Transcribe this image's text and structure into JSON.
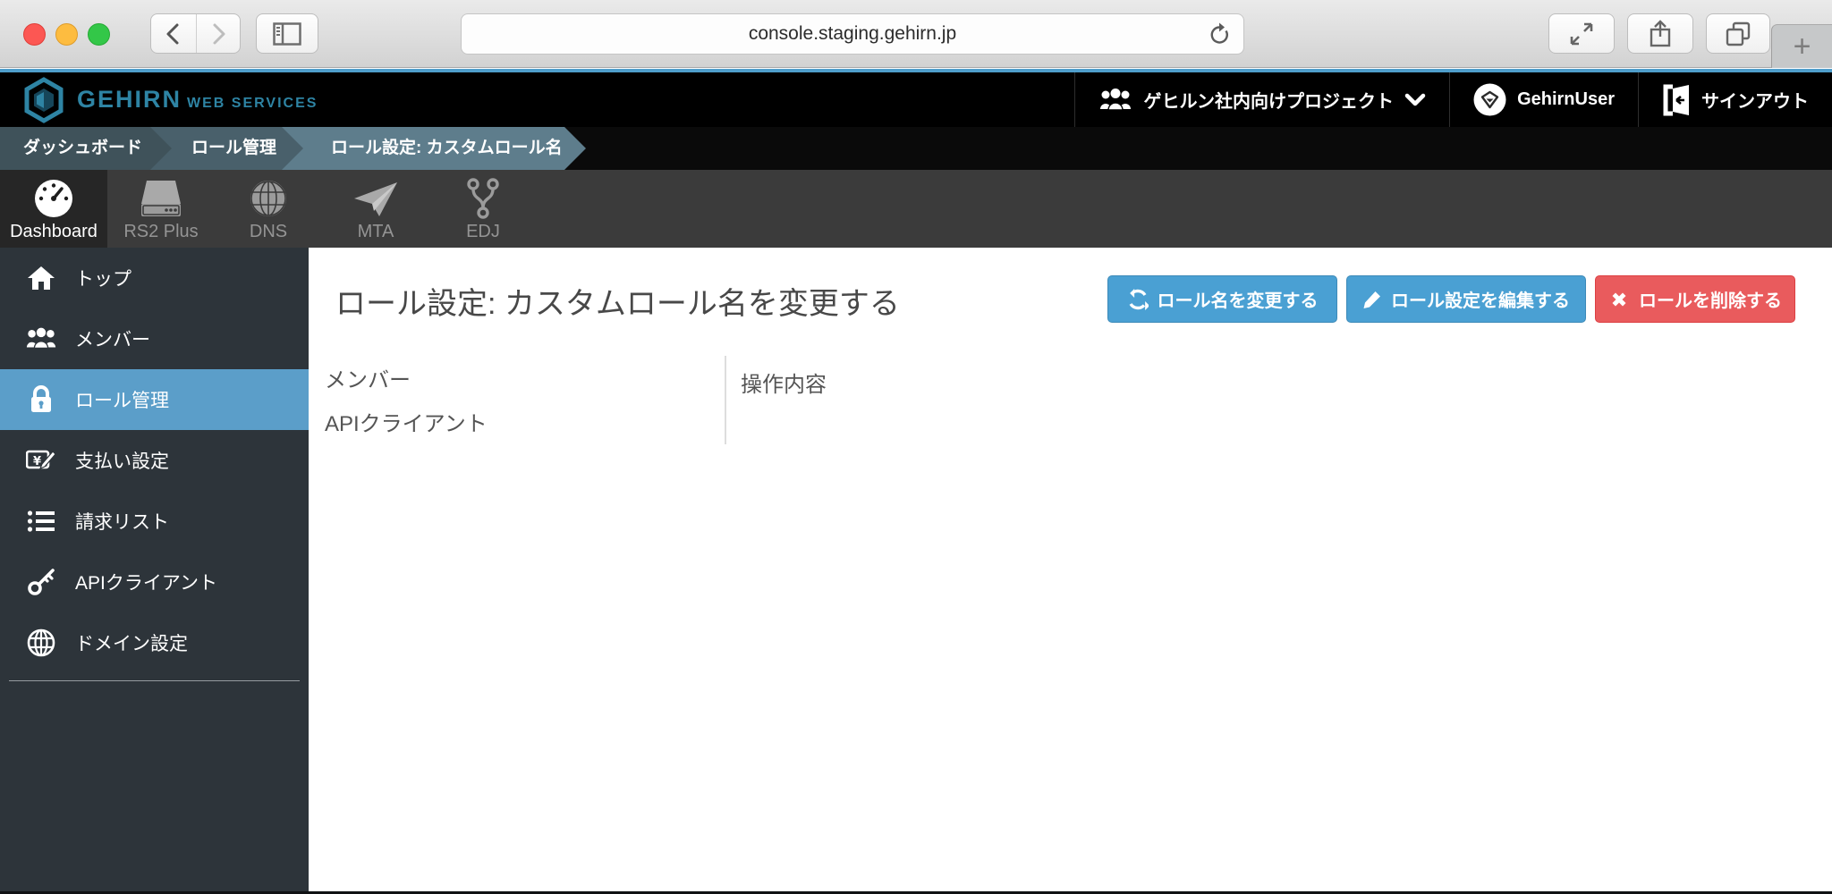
{
  "browser": {
    "url": "console.staging.gehirn.jp",
    "new_tab_label": "+"
  },
  "header": {
    "brand": "GEHIRN",
    "brand_suffix": "WEB SERVICES",
    "project_selector": "ゲヒルン社内向けプロジェクト",
    "user_name": "GehirnUser",
    "signout_label": "サインアウト"
  },
  "breadcrumbs": [
    {
      "label": "ダッシュボード"
    },
    {
      "label": "ロール管理"
    },
    {
      "label": "ロール設定: カスタムロール名"
    }
  ],
  "services_nav": [
    {
      "label": "Dashboard",
      "icon": "gauge-icon",
      "active": true
    },
    {
      "label": "RS2 Plus",
      "icon": "server-icon",
      "active": false
    },
    {
      "label": "DNS",
      "icon": "globe-icon",
      "active": false
    },
    {
      "label": "MTA",
      "icon": "paper-plane-icon",
      "active": false
    },
    {
      "label": "EDJ",
      "icon": "git-branch-icon",
      "active": false
    }
  ],
  "sidebar": {
    "items": [
      {
        "label": "トップ",
        "icon": "home-icon",
        "active": false
      },
      {
        "label": "メンバー",
        "icon": "users-icon",
        "active": false
      },
      {
        "label": "ロール管理",
        "icon": "lock-icon",
        "active": true
      },
      {
        "label": "支払い設定",
        "icon": "payment-icon",
        "active": false
      },
      {
        "label": "請求リスト",
        "icon": "list-icon",
        "active": false
      },
      {
        "label": "APIクライアント",
        "icon": "key-icon",
        "active": false
      },
      {
        "label": "ドメイン設定",
        "icon": "globe-icon",
        "active": false
      }
    ]
  },
  "main": {
    "title": "ロール設定: カスタムロール名を変更する",
    "buttons": [
      {
        "label": "ロール名を変更する",
        "icon": "sync-icon",
        "color": "#4aa0d3"
      },
      {
        "label": "ロール設定を編集する",
        "icon": "pencil-icon",
        "color": "#4aa0d3"
      },
      {
        "label": "ロールを削除する",
        "icon": "x-icon",
        "color": "#e95b5d"
      }
    ],
    "permission_table": {
      "left_items": [
        "メンバー",
        "APIクライアント"
      ],
      "right_header": "操作内容"
    }
  },
  "colors": {
    "accent_line": "#4f9ecb",
    "brand_teal": "#2e84a4",
    "sidebar_bg": "#2d343a",
    "sidebar_active": "#5b9ec9",
    "breadcrumb_1": "#3f525a",
    "breadcrumb_2": "#49606b",
    "breadcrumb_3": "#5e7d8c",
    "button_blue": "#4aa0d3",
    "button_red": "#e95b5d"
  }
}
